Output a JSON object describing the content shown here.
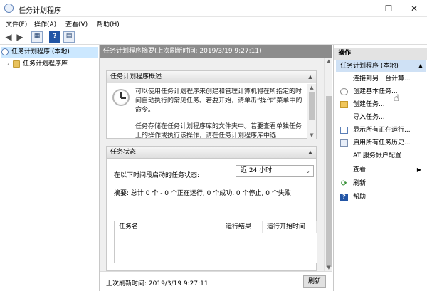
{
  "window": {
    "title": "任务计划程序",
    "min_glyph": "—",
    "max_glyph": "☐",
    "close_glyph": "✕"
  },
  "menu": [
    "文件(F)",
    "操作(A)",
    "查看(V)",
    "帮助(H)"
  ],
  "toolbar": {
    "back_glyph": "◀",
    "forward_glyph": "▶",
    "show_tree_glyph": "▦",
    "help_glyph": "?",
    "props_glyph": "▤"
  },
  "tree": {
    "root": "任务计划程序 (本地)",
    "child": "任务计划程序库",
    "expand_glyph": "›"
  },
  "center": {
    "header": "任务计划程序摘要(上次刷新时间: 2019/3/19 9:27:11)",
    "overview": {
      "title": "任务计划程序概述",
      "para1": "可以使用任务计划程序来创建和管理计算机将在所指定的时间自动执行的常见任务。若要开始，请单击“操作”菜单中的命令。",
      "para2": "任务存储在任务计划程序库的文件夹中。若要查看单独任务上的操作或执行该操作，请在任务计划程序库中选"
    },
    "status": {
      "title": "任务状态",
      "filter_label": "在以下时间段启动的任务状态:",
      "filter_value": "近 24 小时",
      "summary": "摘要: 总计 0 个 - 0 个正在运行, 0 个成功, 0 个停止, 0 个失败",
      "columns": [
        "任务名",
        "运行结果",
        "运行开始时间"
      ]
    },
    "footer": {
      "last_refresh": "上次刷新时间: 2019/3/19 9:27:11",
      "refresh_button": "刷新"
    }
  },
  "actions": {
    "title": "操作",
    "group": "任务计划程序 (本地)",
    "items": [
      {
        "label": "连接到另一台计算...",
        "icon": "none"
      },
      {
        "label": "创建基本任务...",
        "icon": "wizard-icon"
      },
      {
        "label": "创建任务...",
        "icon": "new-task-icon"
      },
      {
        "label": "导入任务...",
        "icon": "none"
      },
      {
        "label": "显示所有正在运行...",
        "icon": "list-icon"
      },
      {
        "label": "启用所有任务历史...",
        "icon": "history-icon"
      },
      {
        "label": "AT 服务帐户配置",
        "icon": "none"
      },
      {
        "label": "查看",
        "icon": "none",
        "submenu": "▶"
      },
      {
        "label": "刷新",
        "icon": "refresh-icon"
      },
      {
        "label": "帮助",
        "icon": "help-icon"
      }
    ]
  }
}
